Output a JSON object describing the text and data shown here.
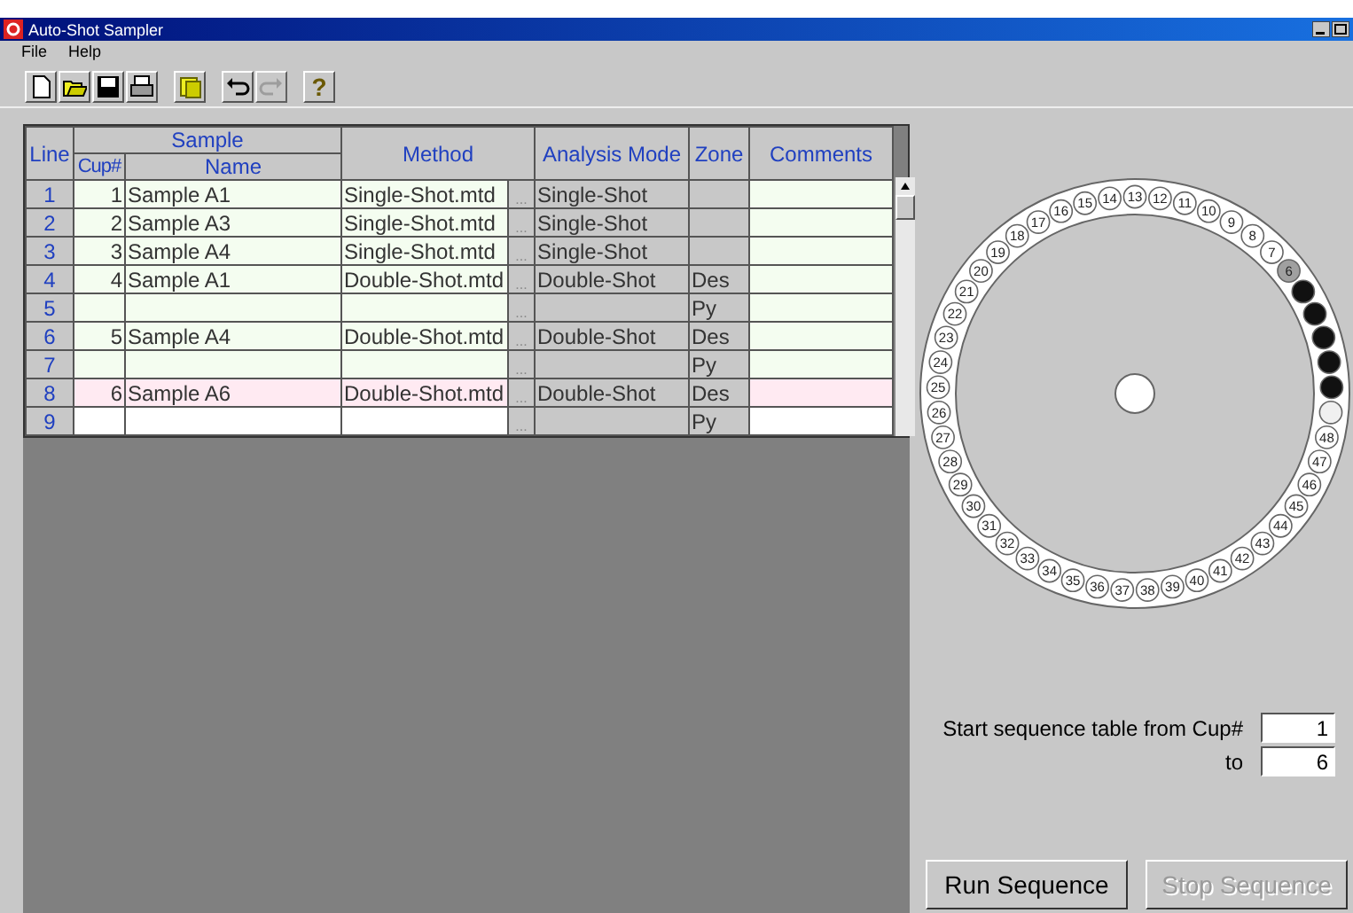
{
  "window": {
    "title": "Auto-Shot Sampler"
  },
  "menu": [
    "File",
    "Help"
  ],
  "toolbar": [
    {
      "kind": "new",
      "disabled": false
    },
    {
      "kind": "open",
      "disabled": false
    },
    {
      "kind": "save",
      "disabled": false
    },
    {
      "kind": "print",
      "disabled": false
    },
    {
      "kind": "sep"
    },
    {
      "kind": "tray",
      "disabled": false
    },
    {
      "kind": "sep"
    },
    {
      "kind": "undo",
      "disabled": false
    },
    {
      "kind": "redo",
      "disabled": true
    },
    {
      "kind": "sep"
    },
    {
      "kind": "help",
      "label": "?",
      "disabled": false
    }
  ],
  "table": {
    "columns": {
      "line": "Line",
      "sample": "Sample",
      "cup": "Cup#",
      "name": "Name",
      "method": "Method",
      "analysis_mode": "Analysis Mode",
      "zone": "Zone",
      "comments": "Comments"
    },
    "rows": [
      {
        "line": "1",
        "cup": "1",
        "name": "Sample A1",
        "method": "Single-Shot.mtd",
        "method_button": "...",
        "analysis_mode": "Single-Shot",
        "color": "#f4fdf0"
      },
      {
        "line": "2",
        "cup": "2",
        "name": "Sample A3",
        "method": "Single-Shot.mtd",
        "method_button": "...",
        "analysis_mode": "Single-Shot",
        "color": "#f4fdf0"
      },
      {
        "line": "3",
        "cup": "3",
        "name": "Sample A4",
        "method": "Single-Shot.mtd",
        "method_button": "...",
        "analysis_mode": "Single-Shot",
        "color": "#f4fdf0"
      },
      {
        "line": "4",
        "cup": "4",
        "name": "Sample A1",
        "method": "Double-Shot.mtd",
        "method_button": "...",
        "analysis_mode": "Double-Shot",
        "zone": "Des",
        "color": "#f4fdf0"
      },
      {
        "line": "5",
        "method_button": "...",
        "zone": "Py",
        "color": "#f4fdf0"
      },
      {
        "line": "6",
        "cup": "5",
        "name": "Sample A4",
        "method": "Double-Shot.mtd",
        "method_button": "...",
        "analysis_mode": "Double-Shot",
        "zone": "Des",
        "color": "#f4fdf0"
      },
      {
        "line": "7",
        "method_button": "...",
        "zone": "Py",
        "color": "#f4fdf0"
      },
      {
        "line": "8",
        "cup": "6",
        "name": "Sample A6",
        "method": "Double-Shot.mtd",
        "method_button": "...",
        "analysis_mode": "Double-Shot",
        "zone": "Des",
        "color": "#ffeaf2"
      },
      {
        "line": "9",
        "method_button": "...",
        "zone": "Py",
        "color": "#ffffff"
      }
    ]
  },
  "tray": {
    "cups": [
      {
        "label": "15",
        "kind": "empty"
      },
      {
        "label": "14",
        "kind": "empty"
      },
      {
        "label": "13",
        "kind": "empty"
      },
      {
        "label": "12",
        "kind": "empty"
      },
      {
        "label": "11",
        "kind": "empty"
      },
      {
        "label": "17",
        "kind": "empty"
      },
      {
        "label": "16",
        "kind": "empty"
      },
      {
        "label": "10",
        "kind": "empty"
      },
      {
        "label": "9",
        "kind": "empty"
      },
      {
        "label": "18",
        "kind": "empty"
      },
      {
        "label": "8",
        "kind": "empty"
      },
      {
        "label": "19",
        "kind": "empty"
      },
      {
        "label": "7",
        "kind": "empty"
      },
      {
        "label": "20",
        "kind": "empty"
      },
      {
        "label": "6",
        "kind": "current"
      },
      {
        "label": "21",
        "kind": "empty"
      },
      {
        "kind": "loaded"
      },
      {
        "label": "22",
        "kind": "empty"
      },
      {
        "kind": "loaded"
      },
      {
        "label": "23",
        "kind": "empty"
      },
      {
        "kind": "loaded"
      },
      {
        "label": "24",
        "kind": "empty"
      },
      {
        "kind": "loaded"
      },
      {
        "label": "25",
        "kind": "empty"
      },
      {
        "kind": "loaded"
      },
      {
        "label": "26",
        "kind": "empty"
      },
      {
        "kind": "home"
      },
      {
        "label": "27",
        "kind": "empty"
      },
      {
        "label": "48",
        "kind": "empty"
      },
      {
        "label": "28",
        "kind": "empty"
      },
      {
        "label": "47",
        "kind": "empty"
      },
      {
        "label": "29",
        "kind": "empty"
      },
      {
        "label": "46",
        "kind": "empty"
      },
      {
        "label": "30",
        "kind": "empty"
      },
      {
        "label": "45",
        "kind": "empty"
      },
      {
        "label": "31",
        "kind": "empty"
      },
      {
        "label": "44",
        "kind": "empty"
      },
      {
        "label": "32",
        "kind": "empty"
      },
      {
        "label": "43",
        "kind": "empty"
      },
      {
        "label": "33",
        "kind": "empty"
      },
      {
        "label": "42",
        "kind": "empty"
      },
      {
        "label": "34",
        "kind": "empty"
      },
      {
        "label": "35",
        "kind": "empty"
      },
      {
        "label": "36",
        "kind": "empty"
      },
      {
        "label": "37",
        "kind": "empty"
      },
      {
        "label": "38",
        "kind": "empty"
      },
      {
        "label": "39",
        "kind": "empty"
      },
      {
        "label": "40",
        "kind": "empty"
      },
      {
        "label": "41",
        "kind": "empty"
      }
    ]
  },
  "sequence": {
    "from_label": "Start sequence table from Cup#",
    "from": "1",
    "to_label": "to",
    "to": "6"
  },
  "buttons": [
    {
      "label": "Run Sequence",
      "disabled": false
    },
    {
      "label": "Stop Sequence",
      "disabled": true
    }
  ]
}
